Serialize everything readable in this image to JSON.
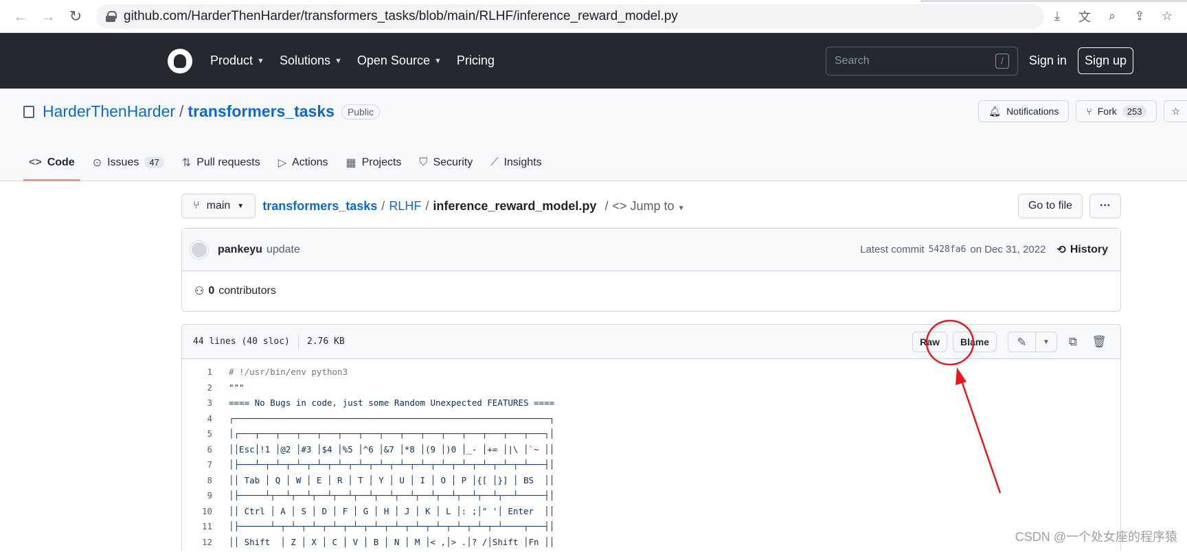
{
  "browser": {
    "url": "github.com/HarderThenHarder/transformers_tasks/blob/main/RLHF/inference_reward_model.py",
    "icons": [
      "back-icon",
      "forward-icon",
      "reload-icon",
      "lock-icon",
      "download-icon",
      "translate-icon",
      "zoom-icon",
      "share-icon",
      "bookmark-icon"
    ]
  },
  "header": {
    "nav": [
      "Product",
      "Solutions",
      "Open Source",
      "Pricing"
    ],
    "search_placeholder": "Search",
    "search_shortcut": "/",
    "sign_in": "Sign in",
    "sign_up": "Sign up"
  },
  "repo": {
    "owner": "HarderThenHarder",
    "separator": "/",
    "name": "transformers_tasks",
    "visibility": "Public",
    "notifications": "Notifications",
    "fork": "Fork",
    "fork_count": "253",
    "tabs": [
      {
        "label": "Code",
        "icon": "code-icon"
      },
      {
        "label": "Issues",
        "count": "47",
        "icon": "issue-icon"
      },
      {
        "label": "Pull requests",
        "icon": "pull-request-icon"
      },
      {
        "label": "Actions",
        "icon": "play-icon"
      },
      {
        "label": "Projects",
        "icon": "table-icon"
      },
      {
        "label": "Security",
        "icon": "shield-icon"
      },
      {
        "label": "Insights",
        "icon": "graph-icon"
      }
    ]
  },
  "path": {
    "branch": "main",
    "repo": "transformers_tasks",
    "sep": "/",
    "folder": "RLHF",
    "file": "inference_reward_model.py",
    "jump": "Jump to",
    "go_to_file": "Go to file",
    "more": "···"
  },
  "commit": {
    "user": "pankeyu",
    "message": "update",
    "latest_label": "Latest commit",
    "hash": "5428fa6",
    "date": "on Dec 31, 2022",
    "history": "History",
    "contributors_count": "0",
    "contributors_label": "contributors"
  },
  "file": {
    "lines": "44 lines (40 sloc)",
    "size": "2.76 KB",
    "raw": "Raw",
    "blame": "Blame",
    "code": [
      "# !/usr/bin/env python3",
      "\"\"\"",
      "==== No Bugs in code, just some Random Unexpected FEATURES ====",
      "┌─────────────────────────────────────────────────────────────┐",
      "│┌───┬───┬───┬───┬───┬───┬───┬───┬───┬───┬───┬───┬───┬───┬───┐│",
      "││Esc│!1 │@2 │#3 │$4 │%5 │^6 │&7 │*8 │(9 │)0 │_- │+= │|\\ │`~ ││",
      "│├───┴─┬─┴─┬─┴─┬─┴─┬─┴─┬─┴─┬─┴─┬─┴─┬─┴─┬─┴─┬─┴─┬─┴─┬─┴─┬─┴───┤│",
      "││ Tab │ Q │ W │ E │ R │ T │ Y │ U │ I │ O │ P │{[ │}] │ BS  ││",
      "│├─────┴┬──┴┬──┴┬──┴┬──┴┬──┴┬──┴┬──┴┬──┴┬──┴┬──┴┬──┴┬──┴─────┤│",
      "││ Ctrl │ A │ S │ D │ F │ G │ H │ J │ K │ L │: ;│\" '│ Enter  ││",
      "│├──────┴─┬─┴─┬─┴─┬─┴─┬─┴─┬─┴─┬─┴─┬─┴─┬─┴─┬─┴─┬─┴─┬─┴────┬───┤│",
      "││ Shift  │ Z │ X │ C │ V │ B │ N │ M │< ,│> .│? /│Shift │Fn ││",
      "│└─────┬──┴┬──┴──┬┴───┴───┴───┴───┴───┴──┬┴───┴┬──┴┬─────┴───┘│"
    ]
  },
  "annotation": {
    "color": "#e8171d"
  },
  "watermark": "CSDN @一个处女座的程序猿"
}
